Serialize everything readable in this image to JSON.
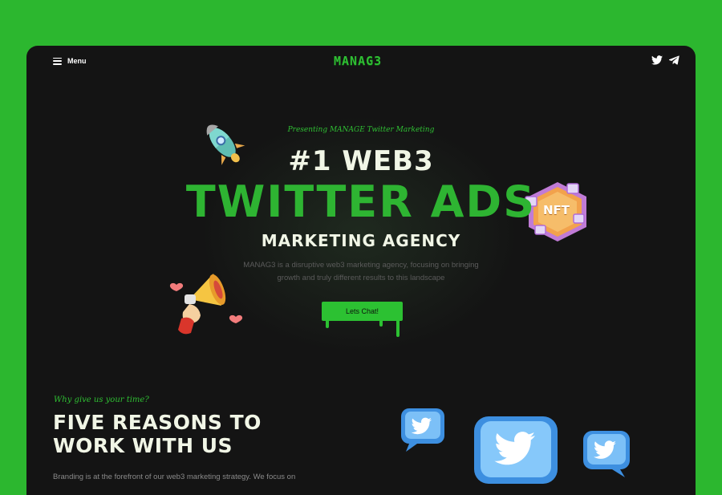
{
  "nav": {
    "menu_label": "Menu",
    "logo": "MANAG3",
    "socials": [
      {
        "icon": "twitter-icon"
      },
      {
        "icon": "telegram-icon"
      }
    ]
  },
  "hero": {
    "eyebrow": "Presenting MANAGE Twitter Marketing",
    "headline_1": "#1 WEB3",
    "headline_2": "TWITTER ADS",
    "headline_3": "MARKETING AGENCY",
    "description": "MANAG3 is a disruptive web3 marketing agency, focusing on bringing growth and truly different results to this landscape",
    "cta_label": "Lets Chat!",
    "nft_badge": "NFT"
  },
  "reasons": {
    "eyebrow": "Why give us your time?",
    "title": "FIVE REASONS TO WORK WITH US",
    "body": "Branding is at the forefront of our web3 marketing strategy. We focus on"
  },
  "colors": {
    "background": "#2cb72f",
    "window": "#141414",
    "accent": "#2eb432",
    "heading_light": "#f1f6e6"
  }
}
